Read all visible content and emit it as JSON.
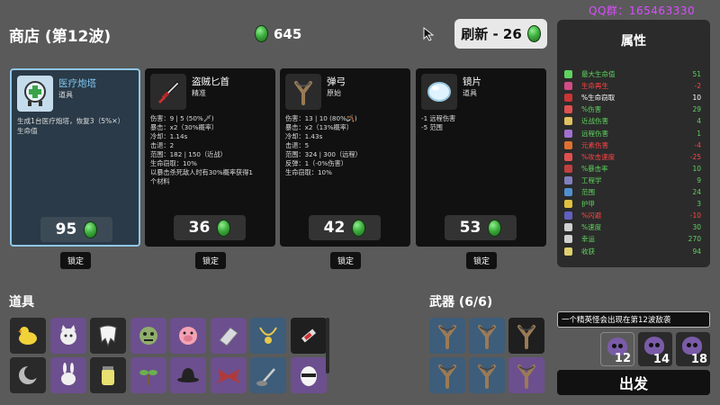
{
  "header": {
    "title": "商店 (第12波)",
    "currency": "645",
    "refresh_label": "刷新 - 26",
    "watermark": "QQ群：165463330"
  },
  "cards": [
    {
      "name": "医疗炮塔",
      "type": "道具",
      "lines": [
        "生成1台医疗炮塔，恢复3（5%✕）",
        "生命值"
      ],
      "price": "95",
      "lock": "锁定",
      "icon": "medical-turret-icon",
      "selected": true
    },
    {
      "name": "盗贼匕首",
      "type": "精准",
      "lines": [
        "伤害：9 | 5 (50%🗡)",
        "暴击：x2（30%概率）",
        "冷却：1.14s",
        "击退：2",
        "范围：182 | 150（近战）",
        "生命窃取：10%",
        "以暴击杀死敌人时有30%概率获得1",
        "个材料"
      ],
      "price": "36",
      "lock": "锁定",
      "icon": "rogue-dagger-icon",
      "selected": false
    },
    {
      "name": "弹弓",
      "type": "原始",
      "lines": [
        "伤害：13 | 10 (80%🪃)",
        "暴击：x2（13%概率）",
        "冷却：1.43s",
        "击退：5",
        "范围：324 | 300（远程）",
        "反弹：1（-0%伤害）",
        "生命窃取：10%"
      ],
      "price": "42",
      "lock": "锁定",
      "icon": "slingshot-icon",
      "selected": false
    },
    {
      "name": "镜片",
      "type": "道具",
      "lines": [
        "-1 远程伤害",
        "-5 范围"
      ],
      "price": "53",
      "lock": "锁定",
      "icon": "lens-icon",
      "selected": false
    }
  ],
  "stats": {
    "title": "属性",
    "rows": [
      {
        "label": "最大生命值",
        "value": "51",
        "color": "#5fd35f",
        "icon_color": "#5fd35f"
      },
      {
        "label": "生命再生",
        "value": "-2",
        "color": "#ff4444",
        "icon_color": "#d24b86"
      },
      {
        "label": "%生命窃取",
        "value": "10",
        "color": "#ffffff",
        "icon_color": "#c93535"
      },
      {
        "label": "%伤害",
        "value": "29",
        "color": "#5fd35f",
        "icon_color": "#e05050"
      },
      {
        "label": "近战伤害",
        "value": "4",
        "color": "#5fd35f",
        "icon_color": "#e0c060"
      },
      {
        "label": "远程伤害",
        "value": "1",
        "color": "#5fd35f",
        "icon_color": "#a070d0"
      },
      {
        "label": "元素伤害",
        "value": "-4",
        "color": "#ff4444",
        "icon_color": "#e07030"
      },
      {
        "label": "%攻击速度",
        "value": "-25",
        "color": "#ff4444",
        "icon_color": "#e05050"
      },
      {
        "label": "%暴击率",
        "value": "10",
        "color": "#5fd35f",
        "icon_color": "#c04040"
      },
      {
        "label": "工程学",
        "value": "9",
        "color": "#5fd35f",
        "icon_color": "#8080c0"
      },
      {
        "label": "范围",
        "value": "24",
        "color": "#5fd35f",
        "icon_color": "#5090d0"
      },
      {
        "label": "护甲",
        "value": "3",
        "color": "#5fd35f",
        "icon_color": "#e0c040"
      },
      {
        "label": "%闪避",
        "value": "-10",
        "color": "#ff4444",
        "icon_color": "#6060c0"
      },
      {
        "label": "%速度",
        "value": "30",
        "color": "#5fd35f",
        "icon_color": "#d0d0d0"
      },
      {
        "label": "幸运",
        "value": "270",
        "color": "#5fd35f",
        "icon_color": "#d0d0d0"
      },
      {
        "label": "收获",
        "value": "94",
        "color": "#5fd35f",
        "icon_color": "#e0d070"
      }
    ]
  },
  "items": {
    "heading": "道具",
    "slots": [
      {
        "name": "duck-icon",
        "tier": "white"
      },
      {
        "name": "cat-icon",
        "tier": "purple"
      },
      {
        "name": "tooth-icon",
        "tier": "white"
      },
      {
        "name": "zombie-icon",
        "tier": "purple"
      },
      {
        "name": "pig-icon",
        "tier": "purple"
      },
      {
        "name": "eraser-icon",
        "tier": "purple"
      },
      {
        "name": "necklace-icon",
        "tier": "blue"
      },
      {
        "name": "syringe-icon",
        "tier": "dark"
      },
      {
        "name": "crescent-icon",
        "tier": "white"
      },
      {
        "name": "rabbit-icon",
        "tier": "purple"
      },
      {
        "name": "jar-icon",
        "tier": "white"
      },
      {
        "name": "sprout-icon",
        "tier": "purple"
      },
      {
        "name": "bowler-hat-icon",
        "tier": "purple"
      },
      {
        "name": "bat-wings-icon",
        "tier": "purple"
      },
      {
        "name": "metal-detector-icon",
        "tier": "blue"
      },
      {
        "name": "egg-icon",
        "tier": "purple"
      }
    ]
  },
  "weapons": {
    "heading": "武器 (6/6)",
    "slots": [
      {
        "name": "slingshot-icon",
        "tier": "blue"
      },
      {
        "name": "slingshot-icon",
        "tier": "blue"
      },
      {
        "name": "slingshot-icon",
        "tier": "dark"
      },
      {
        "name": "slingshot-icon",
        "tier": "blue"
      },
      {
        "name": "slingshot-icon",
        "tier": "blue"
      },
      {
        "name": "slingshot-icon",
        "tier": "purple"
      }
    ]
  },
  "elite_banner": "一个精英怪会出现在第12波敌袭",
  "enemy_waves": [
    "12",
    "14",
    "18"
  ],
  "go_label": "出发"
}
